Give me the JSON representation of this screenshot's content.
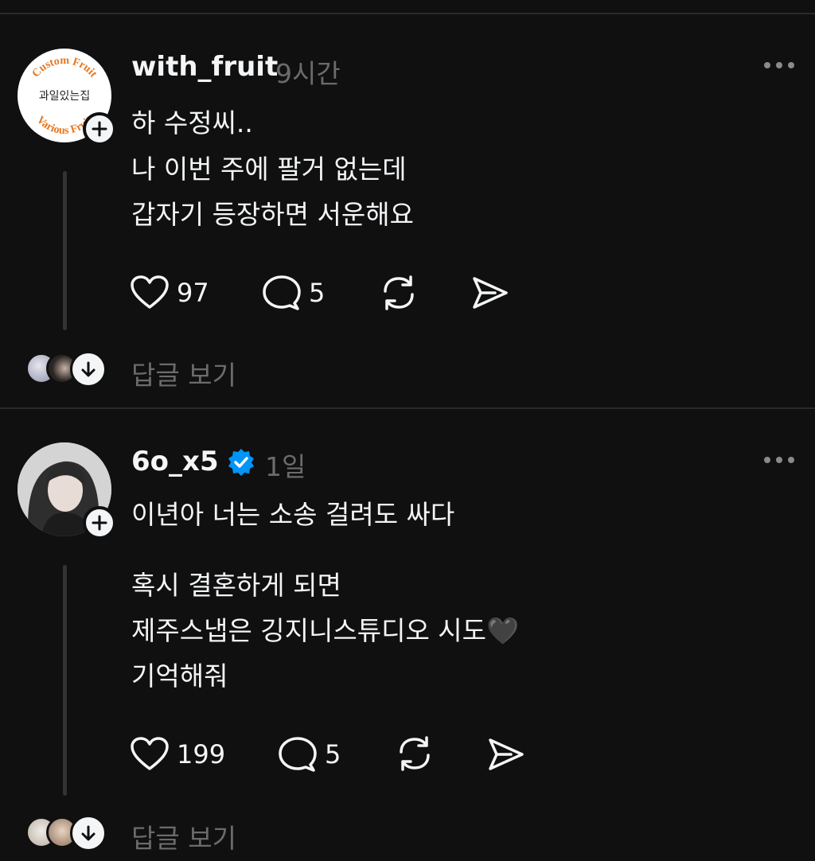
{
  "posts": [
    {
      "avatar": {
        "ring_line1": "Custom Fruit",
        "center_text": "과일있는집",
        "ring_line2": "Various Fruit"
      },
      "username": "with_fruit",
      "time": "9시간",
      "lines": [
        "하 수정씨..",
        "나 이번 주에 팔거 없는데",
        "갑자기 등장하면 서운해요"
      ],
      "likes": "97",
      "comments": "5",
      "view_replies": "답글 보기"
    },
    {
      "username": "6o_x5",
      "verified": true,
      "time": "1일",
      "lines": [
        "이년아 너는 소송 걸려도 싸다",
        "혹시 결혼하게 되면",
        "제주스냅은 깅지니스튜디오 시도🖤",
        "기억해줘"
      ],
      "likes": "199",
      "comments": "5",
      "view_replies": "답글 보기"
    }
  ],
  "colors": {
    "background": "#101010",
    "text": "#f3f5f7",
    "secondary": "#6b6b6b",
    "verified": "#0095f6",
    "fruit_orange": "#e8761e"
  },
  "icons": [
    "heart-icon",
    "comment-icon",
    "repost-icon",
    "share-icon",
    "more-icon",
    "plus-icon",
    "chevron-down-icon",
    "verified-badge-icon"
  ]
}
